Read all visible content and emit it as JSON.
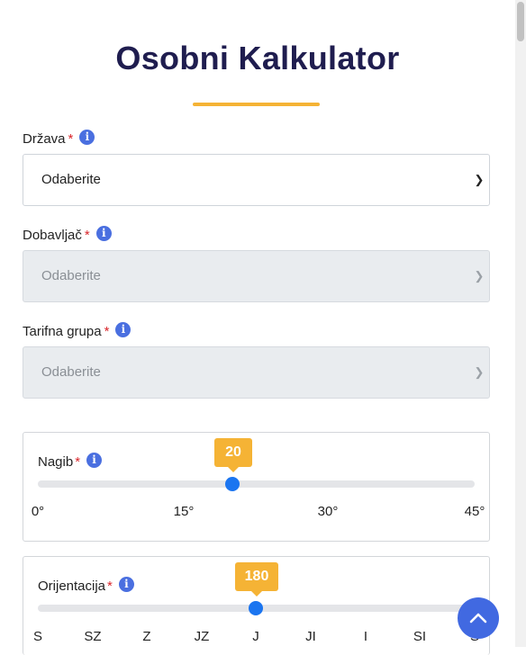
{
  "header": {
    "title": "Osobni Kalkulator"
  },
  "fields": [
    {
      "label": "Država",
      "required": "*",
      "value": "Odaberite",
      "disabled": false
    },
    {
      "label": "Dobavljač",
      "required": "*",
      "value": "Odaberite",
      "disabled": true
    },
    {
      "label": "Tarifna grupa",
      "required": "*",
      "value": "Odaberite",
      "disabled": true
    }
  ],
  "nagib": {
    "label": "Nagib",
    "required": "*",
    "value": "20",
    "min": 0,
    "max": 45,
    "ticks": [
      "0°",
      "15°",
      "30°",
      "45°"
    ]
  },
  "orijentacija": {
    "label": "Orijentacija",
    "required": "*",
    "value": "180",
    "ticks": [
      "S",
      "SZ",
      "Z",
      "JZ",
      "J",
      "JI",
      "I",
      "SI",
      "S"
    ]
  },
  "icons": {
    "info": "info-icon",
    "back_to_top": "chevron-up-icon"
  },
  "colors": {
    "title": "#1f1d4f",
    "accent": "#f5b335",
    "info": "#4a6fe0",
    "slider_thumb": "#1b75f0",
    "required": "#d9262b",
    "to_top": "#4169e1"
  }
}
